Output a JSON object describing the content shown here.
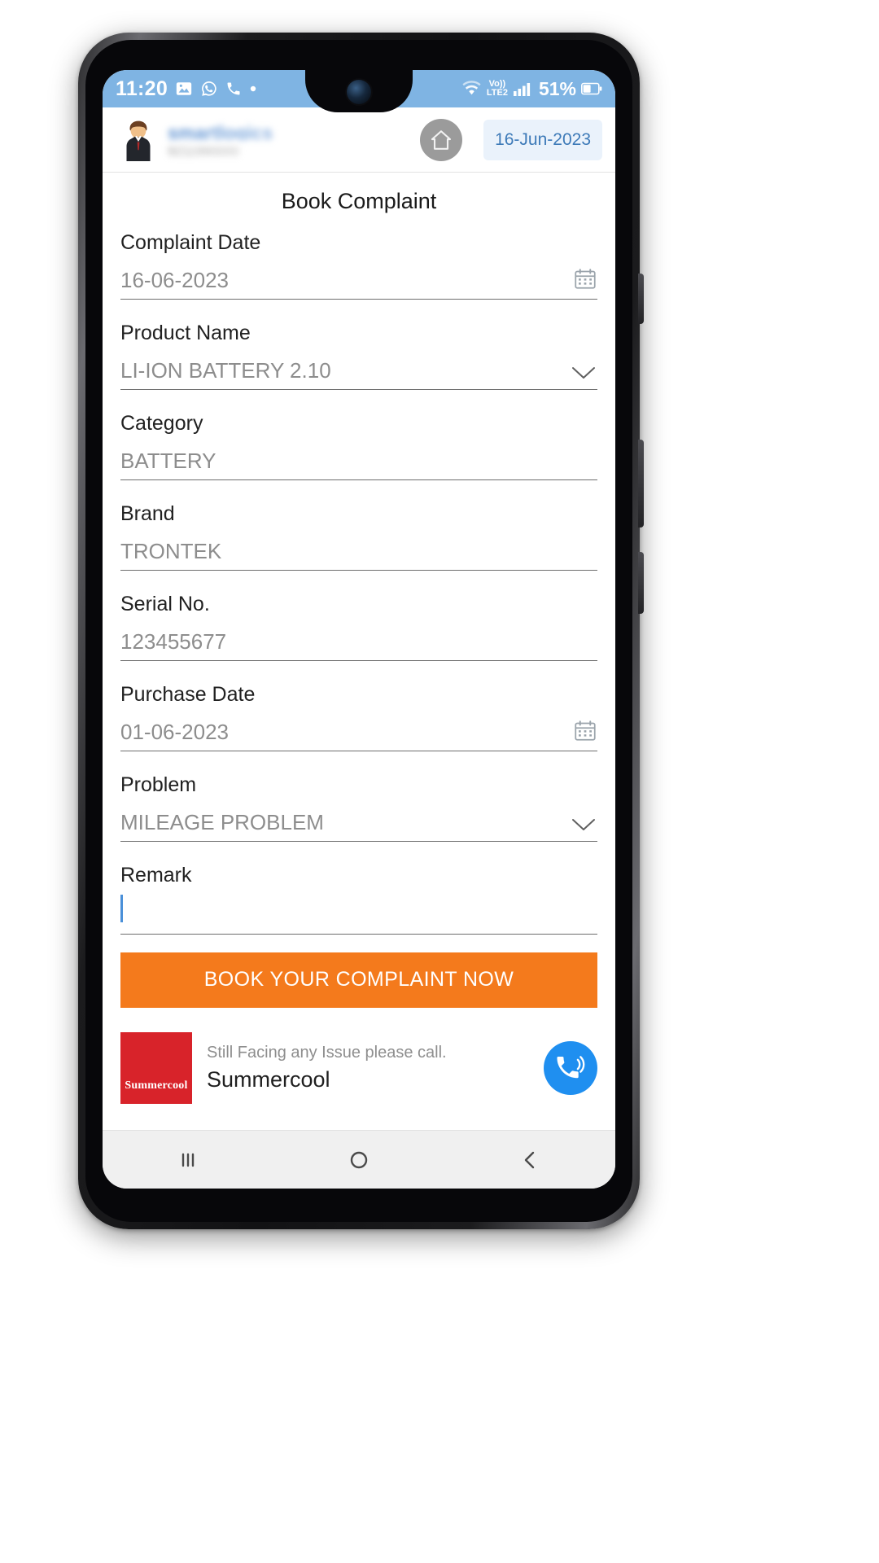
{
  "status_bar": {
    "time": "11:20",
    "left_icons": [
      "photos-icon",
      "whatsapp-icon",
      "phone-call-icon",
      "dot-icon"
    ],
    "right_icons": [
      "wifi-icon",
      "volte-icon",
      "cellular-signal-icon"
    ],
    "network_label": "Vo))",
    "network_sub": "LTE2",
    "battery_percent": "51%",
    "bg_color": "#7fb4e3"
  },
  "header": {
    "user_name": "smartlogics",
    "user_sub": "9211990000",
    "home_icon": "home-icon",
    "date_badge": "16-Jun-2023",
    "date_badge_color": "#3d7ab8"
  },
  "page": {
    "title": "Book Complaint"
  },
  "form": {
    "fields": [
      {
        "label": "Complaint Date",
        "value": "16-06-2023",
        "trail_icon": "calendar-icon",
        "type": "date"
      },
      {
        "label": "Product Name",
        "value": "LI-ION BATTERY 2.10",
        "trail_icon": "chevron-down-icon",
        "type": "select"
      },
      {
        "label": "Category",
        "value": "BATTERY",
        "trail_icon": "",
        "type": "text"
      },
      {
        "label": "Brand",
        "value": "TRONTEK",
        "trail_icon": "",
        "type": "text"
      },
      {
        "label": "Serial No.",
        "value": "123455677",
        "trail_icon": "",
        "type": "text"
      },
      {
        "label": "Purchase Date",
        "value": "01-06-2023",
        "trail_icon": "calendar-icon",
        "type": "date"
      },
      {
        "label": "Problem",
        "value": "MILEAGE PROBLEM",
        "trail_icon": "chevron-down-icon",
        "type": "select"
      },
      {
        "label": "Remark",
        "value": "",
        "trail_icon": "",
        "type": "text-focused"
      }
    ]
  },
  "submit": {
    "label": "BOOK YOUR COMPLAINT NOW",
    "color": "#f47a1c"
  },
  "footer": {
    "logo_text": "Summercool",
    "caption": "Still Facing any Issue please call.",
    "brand": "Summercool",
    "call_icon": "phone-volume-icon",
    "logo_color": "#d8232a",
    "call_color": "#1f8ff0"
  },
  "nav_bar": {
    "recents_icon": "recents-icon",
    "home_icon": "home-circle-icon",
    "back_icon": "back-chevron-icon"
  }
}
